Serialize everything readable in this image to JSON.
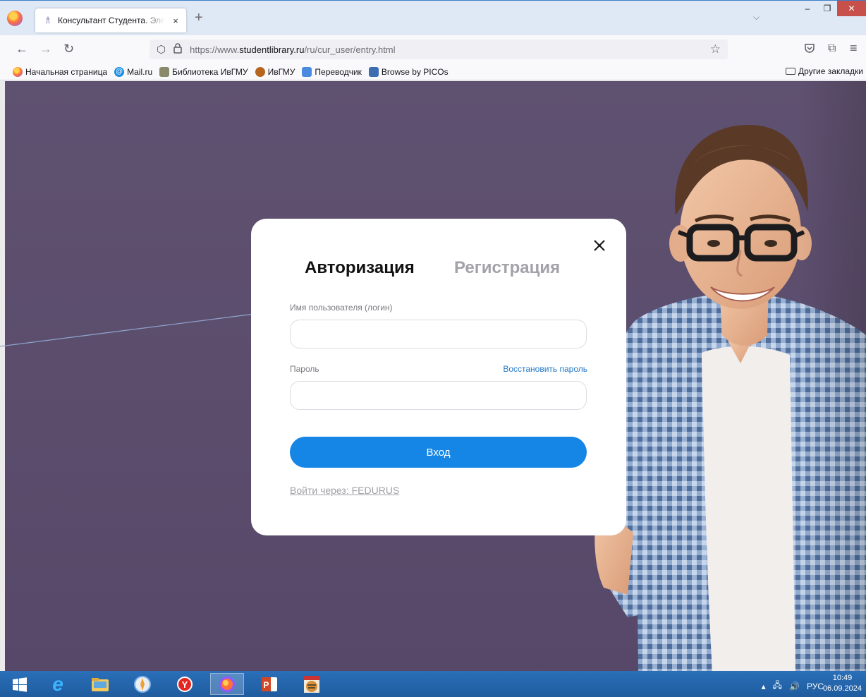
{
  "browser": {
    "tab_title": "Консультант Студента. Электронная библиотека",
    "tab_close": "×",
    "new_tab": "+",
    "tabs_list": "⌵",
    "window": {
      "minimize": "–",
      "maximize": "❐",
      "close": "✕"
    },
    "url": {
      "scheme": "https://www.",
      "domain": "studentlibrary.ru",
      "path": "/ru/cur_user/entry.html"
    },
    "bookmarks": [
      {
        "label": "Начальная страница",
        "color": "#ff7139"
      },
      {
        "label": "Mail.ru",
        "color": "#168de2"
      },
      {
        "label": "Библиотека ИвГМУ",
        "color": "#8a8a6a"
      },
      {
        "label": "ИвГМУ",
        "color": "#b5651d"
      },
      {
        "label": "Переводчик",
        "color": "#4a8bdf"
      },
      {
        "label": "Browse by PICOs",
        "color": "#3d6fb0"
      }
    ],
    "other_bookmarks": "Другие закладки"
  },
  "modal": {
    "tab_login": "Авторизация",
    "tab_register": "Регистрация",
    "login_label": "Имя пользователя (логин)",
    "password_label": "Пароль",
    "restore_password": "Восстановить пароль",
    "login_value": "",
    "password_value": "",
    "submit_label": "Вход",
    "fedurus_link": "Войти через: FEDURUS"
  },
  "taskbar": {
    "tray_lang": "РУС",
    "time": "10:49",
    "date": "06.09.2024"
  },
  "colors": {
    "page_background": "#5b4d6b",
    "accent": "#1686e6",
    "link": "#2579c5"
  }
}
